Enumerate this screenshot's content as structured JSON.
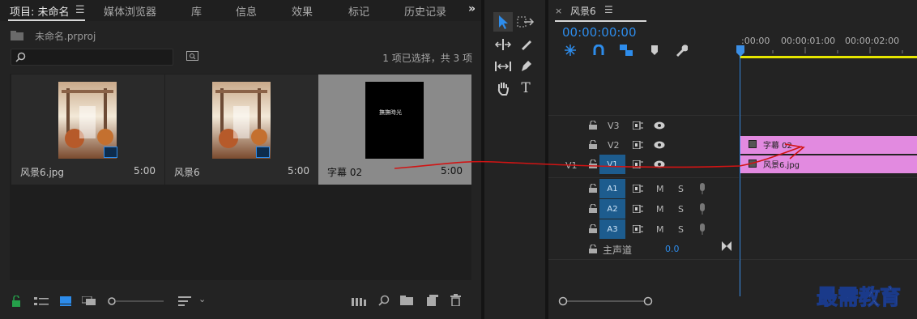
{
  "project_panel": {
    "tabs": [
      {
        "label": "项目: 未命名",
        "active": true
      },
      {
        "label": "媒体浏览器"
      },
      {
        "label": "库"
      },
      {
        "label": "信息"
      },
      {
        "label": "效果"
      },
      {
        "label": "标记"
      },
      {
        "label": "历史记录"
      }
    ],
    "overflow_icon": "double-chevron-right-icon",
    "project_file": "未命名.prproj",
    "search_placeholder": "",
    "selection_status": "1 项已选择，共 3 项",
    "items": [
      {
        "name": "风景6.jpg",
        "duration": "5:00",
        "badge": "still-image-icon",
        "selected": false
      },
      {
        "name": "风景6",
        "duration": "5:00",
        "badge": "sequence-icon",
        "selected": false
      },
      {
        "name": "字幕 02",
        "duration": "5:00",
        "badge": "",
        "selected": true,
        "title_text": "撫撫時光"
      }
    ]
  },
  "timeline": {
    "sequence_name": "风景6",
    "timecode": "00:00:00:00",
    "ruler": [
      ":00:00",
      "00:00:01:00",
      "00:00:02:00"
    ],
    "tracks": [
      {
        "id": "V3",
        "label": "V3"
      },
      {
        "id": "V2",
        "label": "V2"
      },
      {
        "id": "V1",
        "label": "V1",
        "source_label": "V1"
      },
      {
        "id": "A1",
        "label": "A1",
        "m": "M",
        "s": "S"
      },
      {
        "id": "A2",
        "label": "A2",
        "m": "M",
        "s": "S"
      },
      {
        "id": "A3",
        "label": "A3",
        "m": "M",
        "s": "S"
      }
    ],
    "master": {
      "label": "主声道",
      "value": "0.0"
    },
    "clips": [
      {
        "track": "V2",
        "name": "字幕 02"
      },
      {
        "track": "V1",
        "name": "风景6.jpg"
      }
    ]
  },
  "watermark": "最需教育",
  "colors": {
    "accent": "#2d8ceb",
    "clip": "#e28ae0",
    "playhead": "#3b8fe6",
    "track_active": "#1d5c8e",
    "workarea": "#e6e600",
    "annotation": "#d11414"
  }
}
